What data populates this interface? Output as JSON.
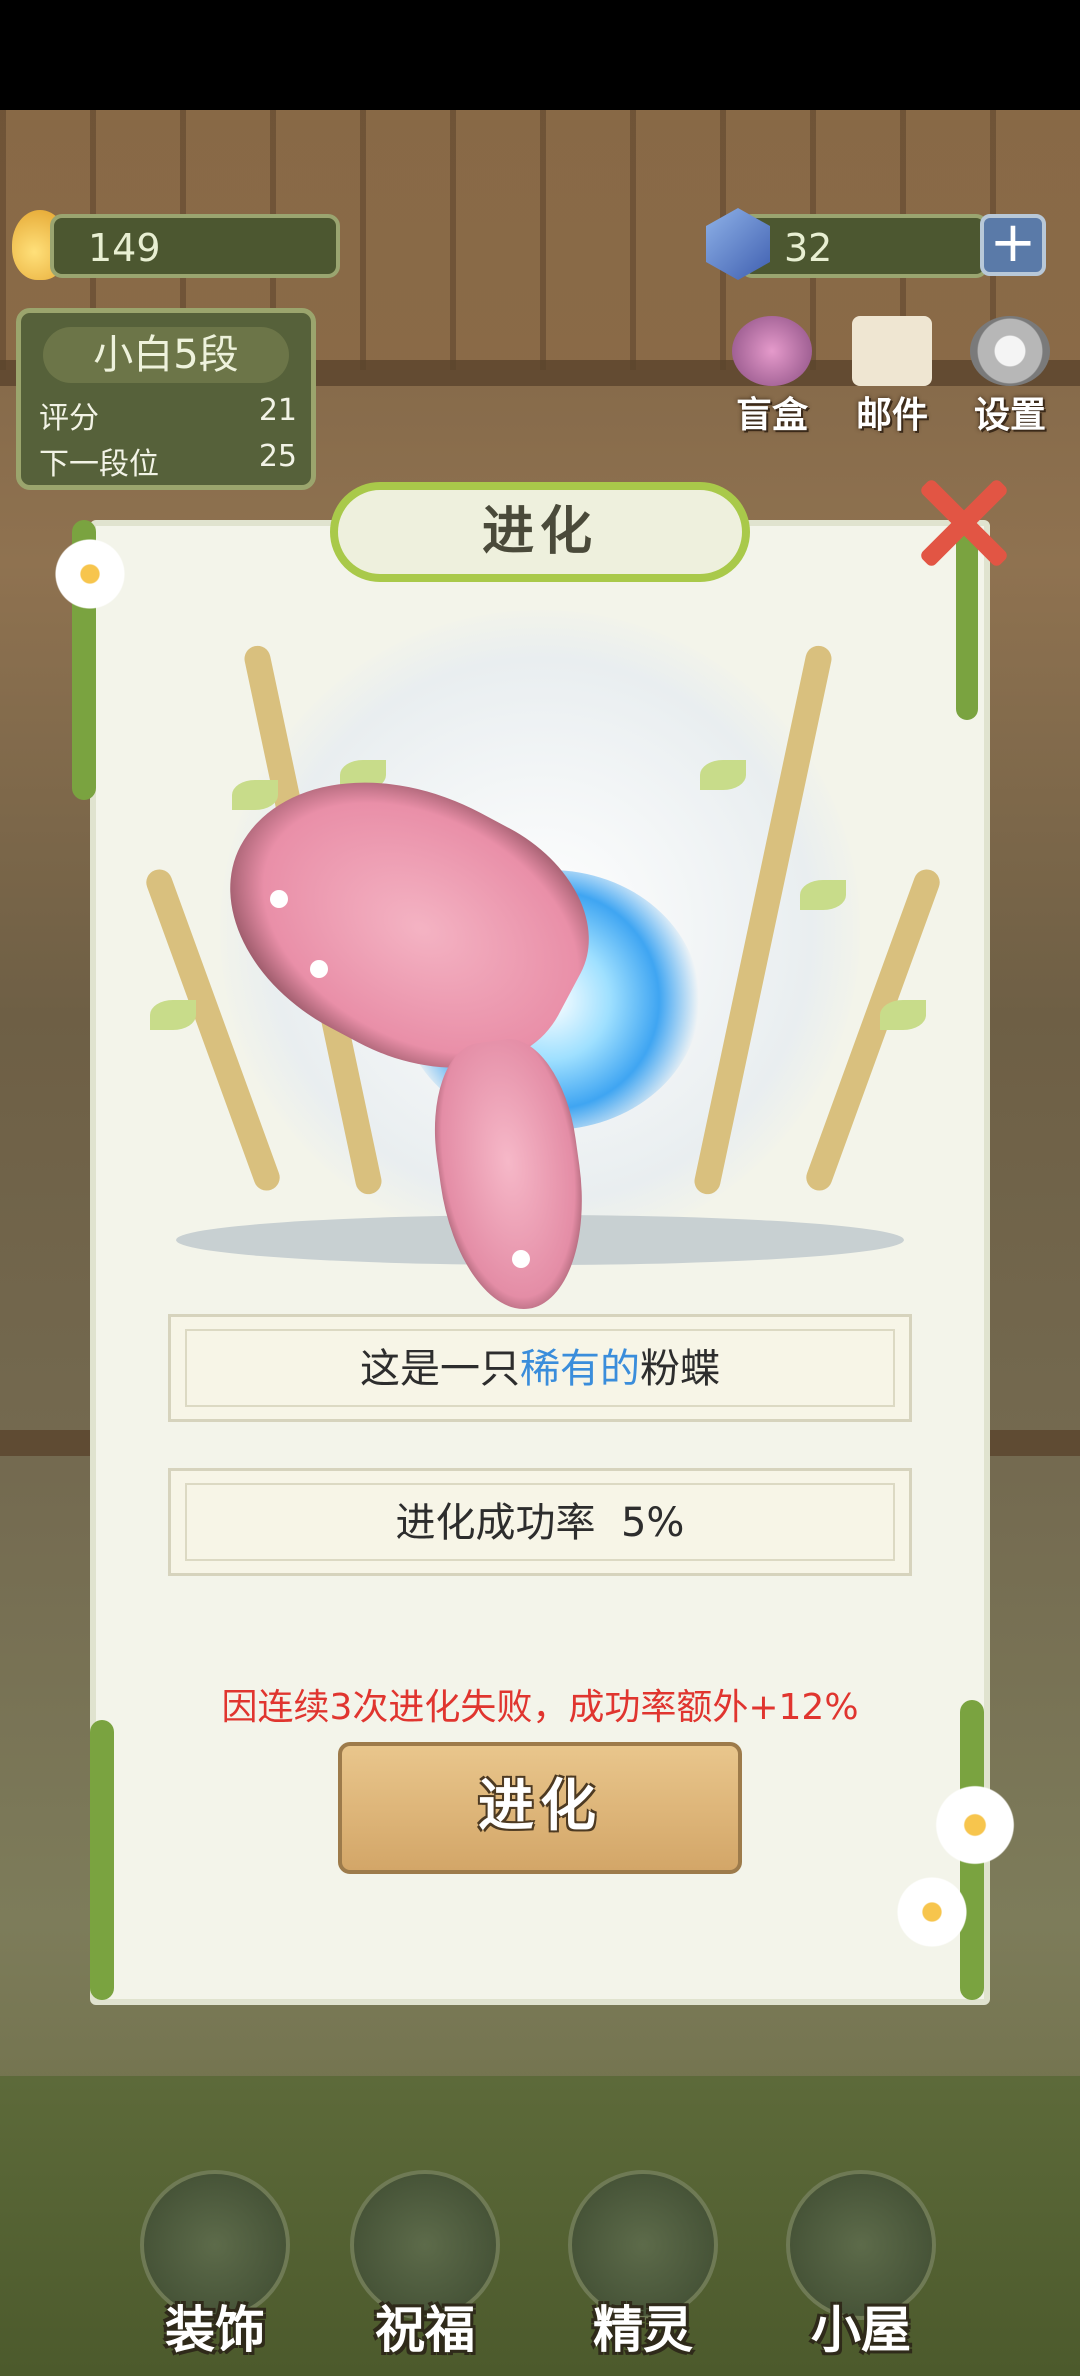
{
  "resources": {
    "coins": "149",
    "gems": "32"
  },
  "rank": {
    "title": "小白5段",
    "score_label": "评分",
    "score_value": "21",
    "next_label": "下一段位",
    "next_value": "25"
  },
  "top_tools": [
    {
      "label": "盲盒",
      "icon": "blind-box-icon"
    },
    {
      "label": "邮件",
      "icon": "mail-icon"
    },
    {
      "label": "设置",
      "icon": "gear-icon"
    }
  ],
  "dialog": {
    "title": "进化",
    "info_prefix": "这是一只",
    "info_rare": "稀有的",
    "info_suffix": "粉蝶",
    "success_rate_label": "进化成功率",
    "success_rate_value": "5%",
    "notice": "因连续3次进化失败，成功率额外+12%",
    "evolve_button": "进化"
  },
  "bottom_nav": [
    {
      "label": "装饰",
      "icon": "plant-pot-icon"
    },
    {
      "label": "祝福",
      "icon": "butterfly-blessing-icon"
    },
    {
      "label": "精灵",
      "icon": "fairy-icon"
    },
    {
      "label": "小屋",
      "icon": "house-icon"
    }
  ],
  "colors": {
    "rare_text": "#3a8ddb",
    "notice_text": "#e0352f",
    "button_bg": "#d3a668",
    "close_x": "#e25544"
  }
}
